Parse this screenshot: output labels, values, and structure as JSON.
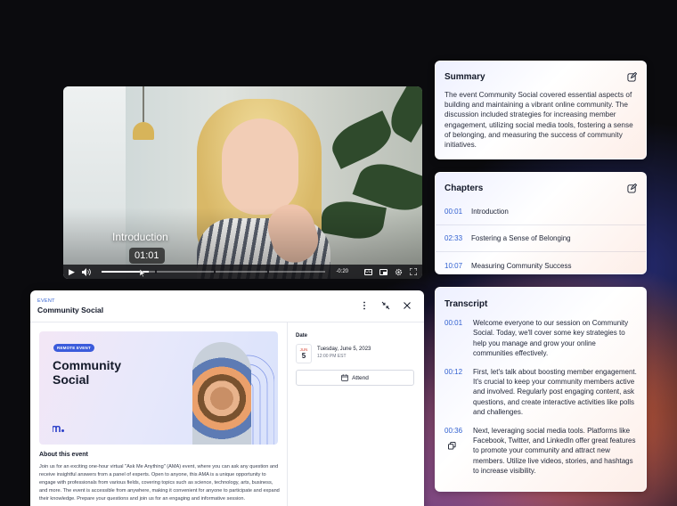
{
  "video": {
    "chapter_caption": "Introduction",
    "hover_time": "01:01",
    "remaining_time": "-0:20",
    "progress": 0.21,
    "icons": [
      "play-icon",
      "volume-icon",
      "cc-icon",
      "pip-icon",
      "settings-icon",
      "fullscreen-icon"
    ]
  },
  "summary": {
    "title": "Summary",
    "text": "The event Community Social covered essential aspects of building and maintaining a vibrant online community. The discussion included strategies for increasing member engagement, utilizing social media tools, fostering a sense of belonging, and measuring the success of community initiatives."
  },
  "chapters": {
    "title": "Chapters",
    "items": [
      {
        "time": "00:01",
        "label": "Introduction"
      },
      {
        "time": "02:33",
        "label": "Fostering a Sense of Belonging"
      },
      {
        "time": "10:07",
        "label": "Measuring Community Success"
      }
    ]
  },
  "transcript": {
    "title": "Transcript",
    "items": [
      {
        "time": "00:01",
        "text": "Welcome everyone to our session on Community Social. Today, we'll cover some key strategies to help you manage and grow your online communities effectively."
      },
      {
        "time": "00:12",
        "text": "First, let's talk about boosting member engagement. It's crucial to keep your community members active and involved. Regularly post engaging content, ask questions, and create interactive activities like polls and challenges."
      },
      {
        "time": "00:36",
        "text": "Next, leveraging social media tools. Platforms like Facebook, Twitter, and LinkedIn offer great features to promote your community and attract new members. Utilize live videos, stories, and hashtags to increase visibility."
      }
    ]
  },
  "event": {
    "kicker": "EVENT",
    "title": "Community Social",
    "banner_tag": "REMOTE EVENT",
    "banner_title": "Community Social",
    "about_title": "About this event",
    "about_text": "Join us for an exciting one-hour virtual \"Ask Me Anything\" (AMA) event, where you can ask any question and receive insightful answers from a panel of experts. Open to anyone, this AMA is a unique opportunity to engage with professionals from various fields, covering topics such as science, technology, arts, business, and more. The event is accessible from anywhere, making it convenient for anyone to participate and expand their knowledge. Prepare your questions and join us for an engaging and informative session.",
    "date_label": "Date",
    "date_month": "JUN",
    "date_day": "5",
    "date_text": "Tuesday, June 5, 2023",
    "time_text": "12:00 PM EST",
    "attend_label": "Attend"
  },
  "colors": {
    "accent": "#2f5fd0",
    "banner_tag": "#3b5bdb",
    "month": "#d64a3a"
  }
}
